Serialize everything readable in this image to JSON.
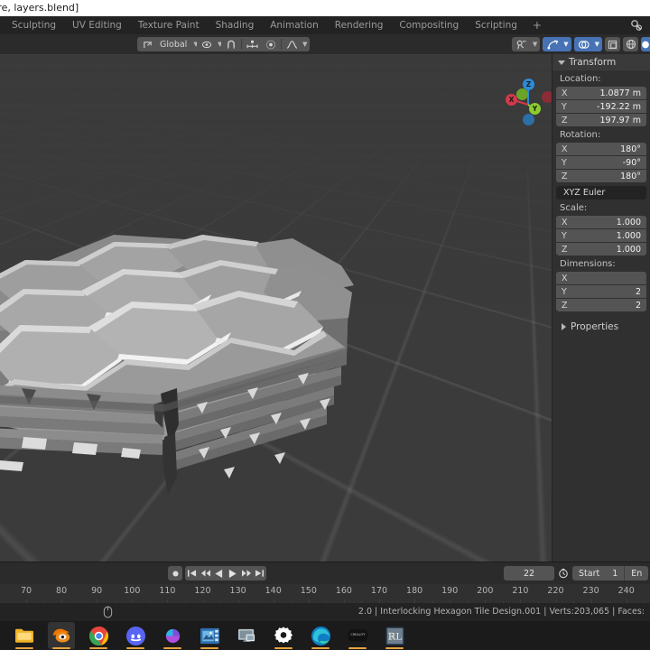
{
  "window": {
    "title": "ture, layers.blend]"
  },
  "topbar": {
    "tabs": [
      {
        "label": "Sculpting",
        "active": false
      },
      {
        "label": "UV Editing",
        "active": false
      },
      {
        "label": "Texture Paint",
        "active": false
      },
      {
        "label": "Shading",
        "active": false
      },
      {
        "label": "Animation",
        "active": false
      },
      {
        "label": "Rendering",
        "active": false
      },
      {
        "label": "Compositing",
        "active": false
      },
      {
        "label": "Scripting",
        "active": false
      }
    ],
    "add_tab_label": "+",
    "right_icon": "render-preview-icon"
  },
  "viewport_header": {
    "orientation_label": "Global",
    "orientation_icon": "transform-orientation-icon",
    "pivot_icon": "pivot-point-icon",
    "snap_magnet_icon": "magnet-icon",
    "snap_to_icon": "snap-increment-icon",
    "proportional_icon": "proportional-editing-icon",
    "falloff_icon": "falloff-curve-icon",
    "dropdown_caret": "chevron-down-icon",
    "right_cluster": [
      {
        "name": "visibility-icon",
        "active": false
      },
      {
        "name": "gizmo-icon",
        "active": true
      },
      {
        "name": "overlays-icon",
        "active": true
      },
      {
        "name": "xray-icon",
        "active": false
      },
      {
        "name": "shading-wireframe-icon",
        "active": false
      },
      {
        "name": "shading-solid-icon",
        "active": false
      }
    ]
  },
  "gizmo": {
    "axes": [
      {
        "label": "X",
        "color": "#d4394a"
      },
      {
        "label": "Y",
        "color": "#8bcd2a"
      },
      {
        "label": "Z",
        "color": "#2e8bd6"
      }
    ]
  },
  "viewport_tools": [
    {
      "name": "zoom-icon"
    },
    {
      "name": "pan-hand-icon"
    },
    {
      "name": "camera-icon"
    },
    {
      "name": "grid-orthographic-icon"
    }
  ],
  "npanel": {
    "title": "Transform",
    "sections": [
      {
        "label": "Location:",
        "rows": [
          {
            "axis": "X",
            "value": "1.0877 m"
          },
          {
            "axis": "Y",
            "value": "-192.22 m"
          },
          {
            "axis": "Z",
            "value": "197.97 m"
          }
        ]
      },
      {
        "label": "Rotation:",
        "rows": [
          {
            "axis": "X",
            "value": "180°"
          },
          {
            "axis": "Y",
            "value": "-90°"
          },
          {
            "axis": "Z",
            "value": "180°"
          }
        ]
      }
    ],
    "rotation_mode": "XYZ Euler",
    "scale": {
      "label": "Scale:",
      "rows": [
        {
          "axis": "X",
          "value": "1.000"
        },
        {
          "axis": "Y",
          "value": "1.000"
        },
        {
          "axis": "Z",
          "value": "1.000"
        }
      ]
    },
    "dimensions": {
      "label": "Dimensions:",
      "rows": [
        {
          "axis": "X",
          "value": ""
        },
        {
          "axis": "Y",
          "value": "2"
        },
        {
          "axis": "Z",
          "value": "2"
        }
      ]
    },
    "properties_label": "Properties"
  },
  "timeline": {
    "record_icon": "record-icon",
    "playback_buttons": [
      {
        "name": "jump-to-start-icon"
      },
      {
        "name": "previous-keyframe-icon"
      },
      {
        "name": "play-reverse-icon"
      },
      {
        "name": "play-icon"
      },
      {
        "name": "next-keyframe-icon"
      },
      {
        "name": "jump-to-end-icon"
      }
    ],
    "current_frame": "22",
    "clock_icon": "use-preview-range-icon",
    "start_label": "Start",
    "start_value": "1",
    "end_label": "En",
    "ruler_ticks": [
      "70",
      "80",
      "90",
      "100",
      "110",
      "120",
      "130",
      "140",
      "150",
      "160",
      "170",
      "180",
      "190",
      "200",
      "210",
      "220",
      "230",
      "240"
    ]
  },
  "statusbar": {
    "mouse_icon": "mouse-left-icon",
    "stats": "2.0 | Interlocking Hexagon Tile Design.001 | Verts:203,065 | Faces:"
  },
  "taskbar": {
    "items": [
      {
        "name": "file-explorer-icon",
        "active": false,
        "running": true
      },
      {
        "name": "blender-icon",
        "active": true,
        "running": true
      },
      {
        "name": "chrome-icon",
        "active": false,
        "running": true
      },
      {
        "name": "discord-icon",
        "active": false,
        "running": true
      },
      {
        "name": "powerpoint-icon",
        "active": false,
        "running": true
      },
      {
        "name": "video-editor-icon",
        "active": false,
        "running": true
      },
      {
        "name": "remote-desktop-icon",
        "active": false,
        "running": false
      },
      {
        "name": "settings-gear-icon",
        "active": false,
        "running": true
      },
      {
        "name": "edge-icon",
        "active": false,
        "running": true
      },
      {
        "name": "creality-icon",
        "active": false,
        "running": true
      },
      {
        "name": "rl-app-icon",
        "active": false,
        "running": true
      }
    ]
  },
  "colors": {
    "viewport_bg": "#3b3b3b",
    "panel_bg": "#303030",
    "header_bg": "#2b2b2b",
    "field_bg": "#545454",
    "accent_blue": "#4772b3",
    "axis_x": "#d4394a",
    "axis_y": "#8bcd2a",
    "axis_z": "#2e8bd6",
    "taskbar_active": "#e8a33d"
  }
}
